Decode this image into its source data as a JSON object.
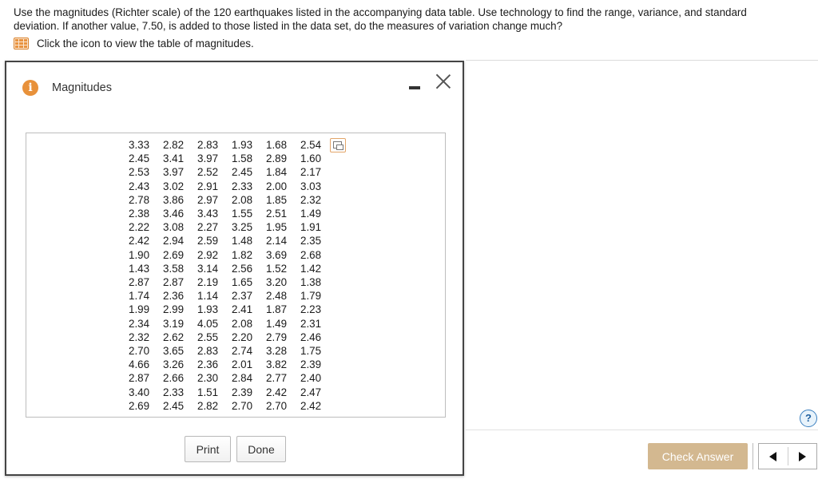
{
  "question": {
    "line1": "Use the magnitudes (Richter scale) of the 120 earthquakes listed in the accompanying data table. Use technology to find the range, variance, and standard",
    "line2": "deviation. If another value, 7.50, is added to those listed in the data set, do the measures of variation change much?",
    "hint": "Click the icon to view the table of magnitudes."
  },
  "dialog": {
    "title": "Magnitudes",
    "rows": [
      [
        "3.33",
        "2.82",
        "2.83",
        "1.93",
        "1.68",
        "2.54"
      ],
      [
        "2.45",
        "3.41",
        "3.97",
        "1.58",
        "2.89",
        "1.60"
      ],
      [
        "2.53",
        "3.97",
        "2.52",
        "2.45",
        "1.84",
        "2.17"
      ],
      [
        "2.43",
        "3.02",
        "2.91",
        "2.33",
        "2.00",
        "3.03"
      ],
      [
        "2.78",
        "3.86",
        "2.97",
        "2.08",
        "1.85",
        "2.32"
      ],
      [
        "2.38",
        "3.46",
        "3.43",
        "1.55",
        "2.51",
        "1.49"
      ],
      [
        "2.22",
        "3.08",
        "2.27",
        "3.25",
        "1.95",
        "1.91"
      ],
      [
        "2.42",
        "2.94",
        "2.59",
        "1.48",
        "2.14",
        "2.35"
      ],
      [
        "1.90",
        "2.69",
        "2.92",
        "1.82",
        "3.69",
        "2.68"
      ],
      [
        "1.43",
        "3.58",
        "3.14",
        "2.56",
        "1.52",
        "1.42"
      ],
      [
        "2.87",
        "2.87",
        "2.19",
        "1.65",
        "3.20",
        "1.38"
      ],
      [
        "1.74",
        "2.36",
        "1.14",
        "2.37",
        "2.48",
        "1.79"
      ],
      [
        "1.99",
        "2.99",
        "1.93",
        "2.41",
        "1.87",
        "2.23"
      ],
      [
        "2.34",
        "3.19",
        "4.05",
        "2.08",
        "1.49",
        "2.31"
      ],
      [
        "2.32",
        "2.62",
        "2.55",
        "2.20",
        "2.79",
        "2.46"
      ],
      [
        "2.70",
        "3.65",
        "2.83",
        "2.74",
        "3.28",
        "1.75"
      ],
      [
        "4.66",
        "3.26",
        "2.36",
        "2.01",
        "3.82",
        "2.39"
      ],
      [
        "2.87",
        "2.66",
        "2.30",
        "2.84",
        "2.77",
        "2.40"
      ],
      [
        "3.40",
        "2.33",
        "1.51",
        "2.39",
        "2.42",
        "2.47"
      ],
      [
        "2.69",
        "2.45",
        "2.82",
        "2.70",
        "2.70",
        "2.42"
      ]
    ],
    "print_label": "Print",
    "done_label": "Done"
  },
  "footer": {
    "check_answer_label": "Check Answer",
    "help_label": "?"
  },
  "colors": {
    "accent_orange": "#e8913a",
    "check_answer_bg": "#d3b890"
  },
  "icons": [
    "table-icon",
    "info-icon",
    "minimize-icon",
    "close-icon",
    "copy-icon",
    "prev-icon",
    "next-icon",
    "help-icon"
  ]
}
